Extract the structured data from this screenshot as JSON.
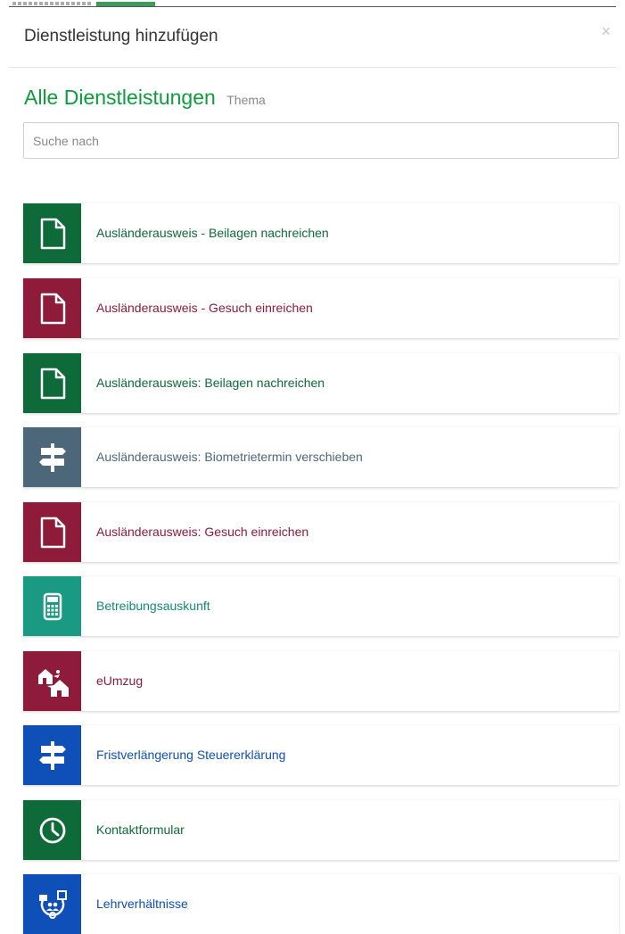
{
  "modal": {
    "title": "Dienstleistung hinzufügen",
    "close": "×"
  },
  "heading": {
    "main": "Alle Dienstleistungen",
    "sub": "Thema"
  },
  "search": {
    "placeholder": "Suche nach"
  },
  "colors": {
    "green": "#0e6a39",
    "crimson": "#8e1b3a",
    "slate": "#4c6779",
    "teal": "#1a9a83",
    "blue": "#0f4fb8",
    "heading": "#0d9b3c"
  },
  "services": [
    {
      "label": "Ausländerausweis - Beilagen nachreichen",
      "icon": "document-icon",
      "color": "#0e6a39",
      "text_color": "#0e6a39"
    },
    {
      "label": "Ausländerausweis - Gesuch einreichen",
      "icon": "document-icon",
      "color": "#8e1b3a",
      "text_color": "#8e1b3a"
    },
    {
      "label": "Ausländerausweis: Beilagen nachreichen",
      "icon": "document-icon",
      "color": "#0e6a39",
      "text_color": "#0e6a39"
    },
    {
      "label": "Ausländerausweis: Biometrietermin verschieben",
      "icon": "signpost-icon",
      "color": "#4c6779",
      "text_color": "#4c6779"
    },
    {
      "label": "Ausländerausweis: Gesuch einreichen",
      "icon": "document-icon",
      "color": "#8e1b3a",
      "text_color": "#8e1b3a"
    },
    {
      "label": "Betreibungsauskunft",
      "icon": "calculator-icon",
      "color": "#1a9a83",
      "text_color": "#138a6e"
    },
    {
      "label": "eUmzug",
      "icon": "moving-houses-icon",
      "color": "#8e1b3a",
      "text_color": "#8e1b3a"
    },
    {
      "label": "Fristverlängerung Steuererklärung",
      "icon": "signpost-icon",
      "color": "#0f4fb8",
      "text_color": "#0f4fb8"
    },
    {
      "label": "Kontaktformular",
      "icon": "clock-icon",
      "color": "#0e6a39",
      "text_color": "#0e6a39"
    },
    {
      "label": "Lehrverhältnisse",
      "icon": "apprenticeship-icon",
      "color": "#0f4fb8",
      "text_color": "#0f4fb8"
    }
  ]
}
